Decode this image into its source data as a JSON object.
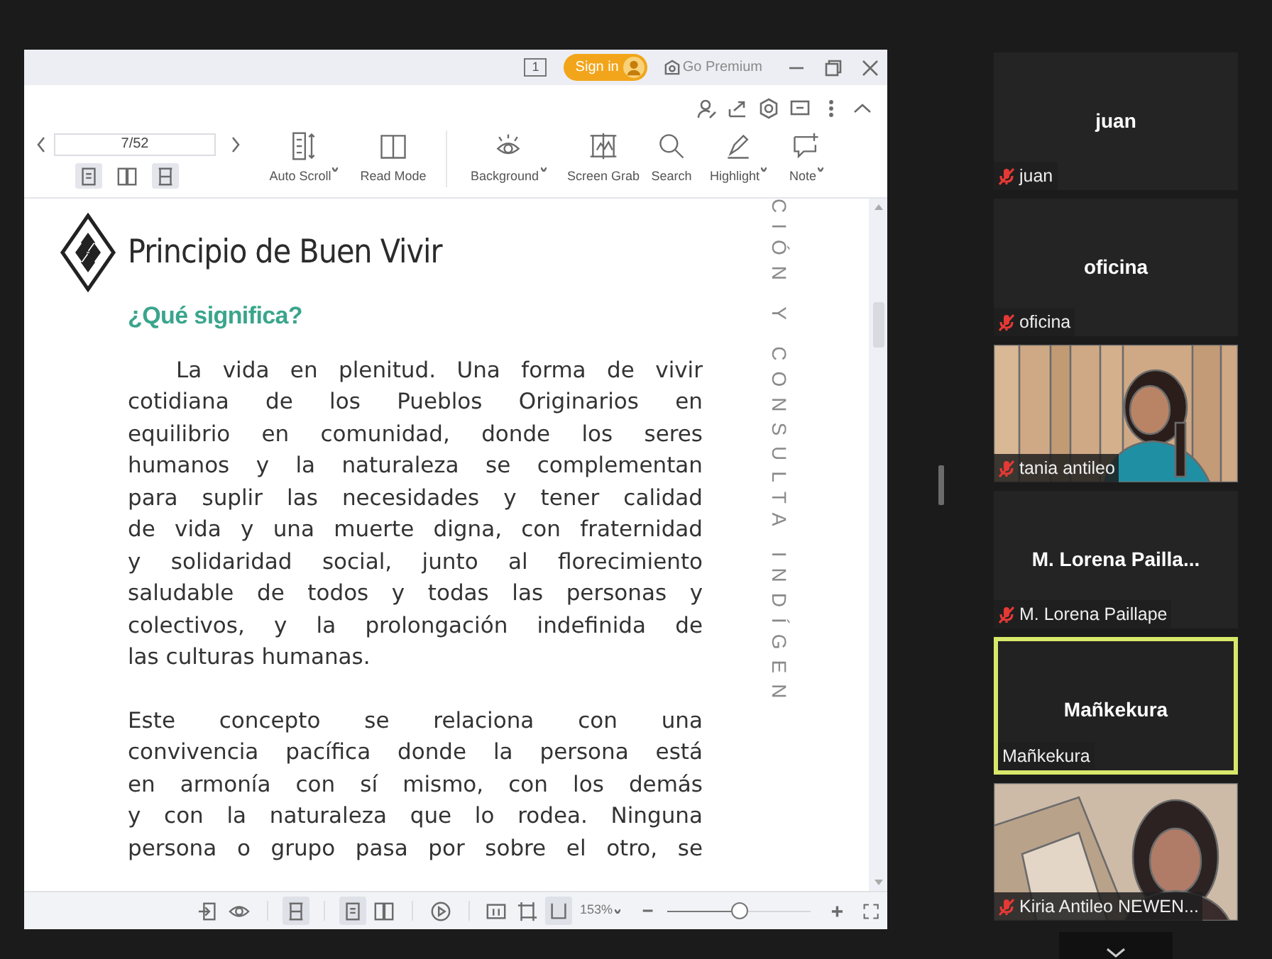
{
  "pdf_reader": {
    "title_bar": {
      "page_badge": "1",
      "sign_in": "Sign in",
      "premium": "Go Premium"
    },
    "page_field": {
      "value": "7/52"
    },
    "view_modes": [
      {
        "kind": "single",
        "selected": true
      },
      {
        "kind": "double",
        "selected": false
      },
      {
        "kind": "continuous",
        "selected": true
      }
    ],
    "tools": [
      {
        "kind": "auto_scroll",
        "label": "Auto Scroll",
        "has_menu": true
      },
      {
        "kind": "read_mode",
        "label": "Read Mode",
        "has_menu": false
      },
      {
        "kind": "background",
        "label": "Background",
        "has_menu": true
      },
      {
        "kind": "screen_grab",
        "label": "Screen Grab",
        "has_menu": false
      },
      {
        "kind": "search",
        "label": "Search",
        "has_menu": false
      },
      {
        "kind": "highlight",
        "label": "Highlight",
        "has_menu": true
      },
      {
        "kind": "note",
        "label": "Note",
        "has_menu": true
      }
    ],
    "document": {
      "heading": "Principio de Buen Vivir",
      "subheading": "¿Qué significa?",
      "paragraphs": [
        {
          "indent": true,
          "complete": true,
          "lines": [
            "La vida en plenitud. Una forma de vivir",
            "cotidiana de los Pueblos Originarios en",
            "equilibrio en comunidad, donde los seres",
            "humanos y la naturaleza se complementan",
            "para suplir las necesidades y tener calidad",
            "de vida y una muerte digna, con fraternidad",
            "y solidaridad social, junto al florecimiento",
            "saludable de todos y todas las personas y",
            "colectivos, y la prolongación indefinida de",
            "las culturas humanas."
          ]
        },
        {
          "indent": false,
          "complete": false,
          "lines": [
            "Este concepto se relaciona con una",
            "convivencia pacífica donde la persona está",
            "en armonía con sí mismo, con los demás",
            "y con la naturaleza que lo rodea. Ninguna",
            "persona o grupo pasa por sobre el otro, se"
          ]
        }
      ],
      "side_text": "CIÓN Y CONSULTA INDÍGEN"
    },
    "status_bar": {
      "buttons": [
        {
          "kind": "exit",
          "selected": false
        },
        {
          "kind": "eye",
          "selected": false
        },
        {
          "kind": "continuous",
          "selected": true
        },
        {
          "kind": "single",
          "selected": true
        },
        {
          "kind": "double",
          "selected": false
        },
        {
          "kind": "play",
          "selected": false
        },
        {
          "kind": "actual",
          "selected": false
        },
        {
          "kind": "fit_page",
          "selected": false
        },
        {
          "kind": "fit_width",
          "selected": true
        }
      ],
      "zoom": "153%",
      "zoom_slider": {
        "level": 0.5
      }
    }
  },
  "participants": [
    {
      "kind": "avatar",
      "title": "juan",
      "label": "juan",
      "muted": true,
      "speaking": false
    },
    {
      "kind": "avatar",
      "title": "oficina",
      "label": "oficina",
      "muted": true,
      "speaking": false
    },
    {
      "kind": "video",
      "label": "tania antileo",
      "muted": true,
      "speaking": false
    },
    {
      "kind": "avatar",
      "title": "M. Lorena Pailla...",
      "label": "M. Lorena Paillape",
      "muted": true,
      "speaking": false
    },
    {
      "kind": "avatar",
      "title": "Mañkekura",
      "label": "Mañkekura",
      "muted": false,
      "speaking": true
    },
    {
      "kind": "video",
      "label": "Kiria Antileo NEWEN...",
      "muted": true,
      "speaking": false
    }
  ]
}
